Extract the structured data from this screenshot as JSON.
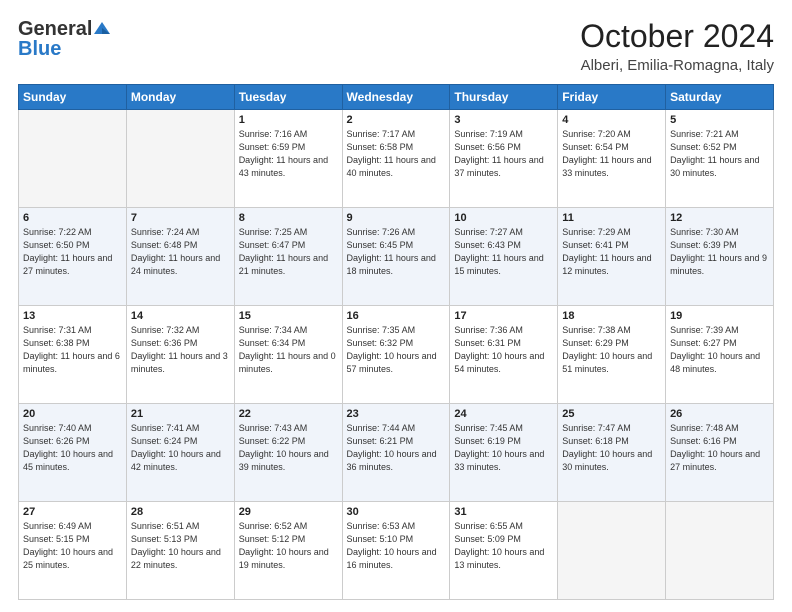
{
  "header": {
    "logo_line1": "General",
    "logo_line2": "Blue",
    "month": "October 2024",
    "location": "Alberi, Emilia-Romagna, Italy"
  },
  "days_of_week": [
    "Sunday",
    "Monday",
    "Tuesday",
    "Wednesday",
    "Thursday",
    "Friday",
    "Saturday"
  ],
  "weeks": [
    [
      {
        "day": "",
        "info": ""
      },
      {
        "day": "",
        "info": ""
      },
      {
        "day": "1",
        "info": "Sunrise: 7:16 AM\nSunset: 6:59 PM\nDaylight: 11 hours and 43 minutes."
      },
      {
        "day": "2",
        "info": "Sunrise: 7:17 AM\nSunset: 6:58 PM\nDaylight: 11 hours and 40 minutes."
      },
      {
        "day": "3",
        "info": "Sunrise: 7:19 AM\nSunset: 6:56 PM\nDaylight: 11 hours and 37 minutes."
      },
      {
        "day": "4",
        "info": "Sunrise: 7:20 AM\nSunset: 6:54 PM\nDaylight: 11 hours and 33 minutes."
      },
      {
        "day": "5",
        "info": "Sunrise: 7:21 AM\nSunset: 6:52 PM\nDaylight: 11 hours and 30 minutes."
      }
    ],
    [
      {
        "day": "6",
        "info": "Sunrise: 7:22 AM\nSunset: 6:50 PM\nDaylight: 11 hours and 27 minutes."
      },
      {
        "day": "7",
        "info": "Sunrise: 7:24 AM\nSunset: 6:48 PM\nDaylight: 11 hours and 24 minutes."
      },
      {
        "day": "8",
        "info": "Sunrise: 7:25 AM\nSunset: 6:47 PM\nDaylight: 11 hours and 21 minutes."
      },
      {
        "day": "9",
        "info": "Sunrise: 7:26 AM\nSunset: 6:45 PM\nDaylight: 11 hours and 18 minutes."
      },
      {
        "day": "10",
        "info": "Sunrise: 7:27 AM\nSunset: 6:43 PM\nDaylight: 11 hours and 15 minutes."
      },
      {
        "day": "11",
        "info": "Sunrise: 7:29 AM\nSunset: 6:41 PM\nDaylight: 11 hours and 12 minutes."
      },
      {
        "day": "12",
        "info": "Sunrise: 7:30 AM\nSunset: 6:39 PM\nDaylight: 11 hours and 9 minutes."
      }
    ],
    [
      {
        "day": "13",
        "info": "Sunrise: 7:31 AM\nSunset: 6:38 PM\nDaylight: 11 hours and 6 minutes."
      },
      {
        "day": "14",
        "info": "Sunrise: 7:32 AM\nSunset: 6:36 PM\nDaylight: 11 hours and 3 minutes."
      },
      {
        "day": "15",
        "info": "Sunrise: 7:34 AM\nSunset: 6:34 PM\nDaylight: 11 hours and 0 minutes."
      },
      {
        "day": "16",
        "info": "Sunrise: 7:35 AM\nSunset: 6:32 PM\nDaylight: 10 hours and 57 minutes."
      },
      {
        "day": "17",
        "info": "Sunrise: 7:36 AM\nSunset: 6:31 PM\nDaylight: 10 hours and 54 minutes."
      },
      {
        "day": "18",
        "info": "Sunrise: 7:38 AM\nSunset: 6:29 PM\nDaylight: 10 hours and 51 minutes."
      },
      {
        "day": "19",
        "info": "Sunrise: 7:39 AM\nSunset: 6:27 PM\nDaylight: 10 hours and 48 minutes."
      }
    ],
    [
      {
        "day": "20",
        "info": "Sunrise: 7:40 AM\nSunset: 6:26 PM\nDaylight: 10 hours and 45 minutes."
      },
      {
        "day": "21",
        "info": "Sunrise: 7:41 AM\nSunset: 6:24 PM\nDaylight: 10 hours and 42 minutes."
      },
      {
        "day": "22",
        "info": "Sunrise: 7:43 AM\nSunset: 6:22 PM\nDaylight: 10 hours and 39 minutes."
      },
      {
        "day": "23",
        "info": "Sunrise: 7:44 AM\nSunset: 6:21 PM\nDaylight: 10 hours and 36 minutes."
      },
      {
        "day": "24",
        "info": "Sunrise: 7:45 AM\nSunset: 6:19 PM\nDaylight: 10 hours and 33 minutes."
      },
      {
        "day": "25",
        "info": "Sunrise: 7:47 AM\nSunset: 6:18 PM\nDaylight: 10 hours and 30 minutes."
      },
      {
        "day": "26",
        "info": "Sunrise: 7:48 AM\nSunset: 6:16 PM\nDaylight: 10 hours and 27 minutes."
      }
    ],
    [
      {
        "day": "27",
        "info": "Sunrise: 6:49 AM\nSunset: 5:15 PM\nDaylight: 10 hours and 25 minutes."
      },
      {
        "day": "28",
        "info": "Sunrise: 6:51 AM\nSunset: 5:13 PM\nDaylight: 10 hours and 22 minutes."
      },
      {
        "day": "29",
        "info": "Sunrise: 6:52 AM\nSunset: 5:12 PM\nDaylight: 10 hours and 19 minutes."
      },
      {
        "day": "30",
        "info": "Sunrise: 6:53 AM\nSunset: 5:10 PM\nDaylight: 10 hours and 16 minutes."
      },
      {
        "day": "31",
        "info": "Sunrise: 6:55 AM\nSunset: 5:09 PM\nDaylight: 10 hours and 13 minutes."
      },
      {
        "day": "",
        "info": ""
      },
      {
        "day": "",
        "info": ""
      }
    ]
  ]
}
